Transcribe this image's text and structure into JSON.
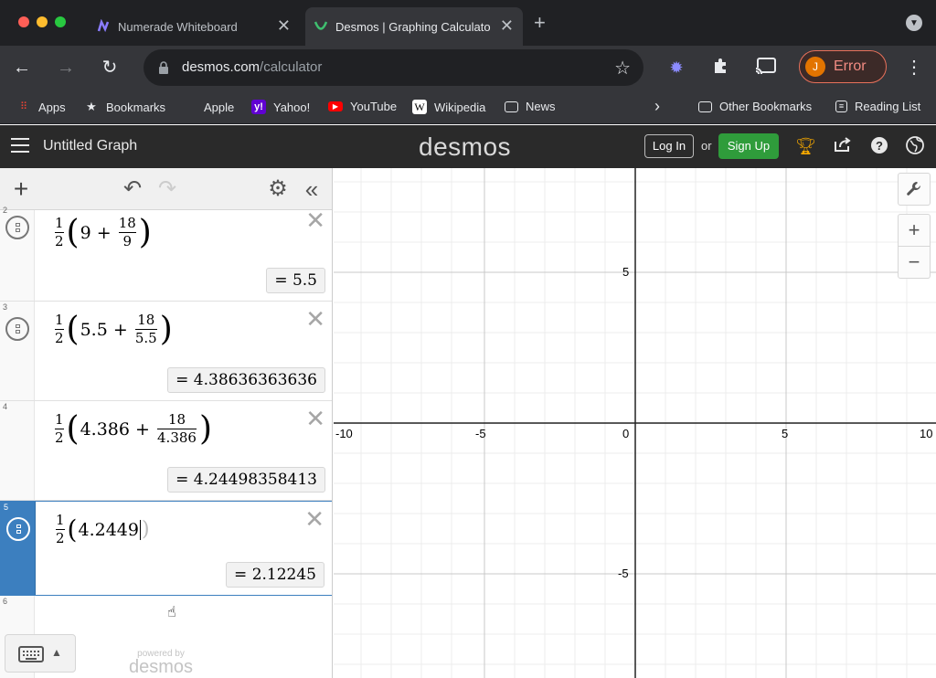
{
  "browser": {
    "tabs": [
      {
        "label": "Numerade Whiteboard",
        "icon": "numerade-icon"
      },
      {
        "label": "Desmos | Graphing Calculator",
        "icon": "desmos-icon"
      }
    ],
    "url_host": "desmos.com",
    "url_path": "/calculator",
    "profile_initial": "J",
    "profile_status": "Error",
    "bookmarks": [
      "Apps",
      "Bookmarks",
      "Apple",
      "Yahoo!",
      "YouTube",
      "Wikipedia",
      "News"
    ],
    "other_bookmarks": "Other Bookmarks",
    "reading_list": "Reading List"
  },
  "desmos": {
    "graph_title": "Untitled Graph",
    "logo": "desmos",
    "login_label": "Log In",
    "or_label": "or",
    "signup_label": "Sign Up",
    "powered_by": "powered by",
    "powered_logo": "desmos"
  },
  "expressions": [
    {
      "number": "2",
      "coef_num": "1",
      "coef_den": "2",
      "term": "9",
      "plus": "+",
      "frac_num": "18",
      "frac_den": "9",
      "result": "= 5.5"
    },
    {
      "number": "3",
      "coef_num": "1",
      "coef_den": "2",
      "term": "5.5",
      "plus": "+",
      "frac_num": "18",
      "frac_den": "5.5",
      "result": "= 4.38636363636"
    },
    {
      "number": "4",
      "coef_num": "1",
      "coef_den": "2",
      "term": "4.386",
      "plus": "+",
      "frac_num": "18",
      "frac_den": "4.386",
      "result": "= 4.24498358413"
    },
    {
      "number": "5",
      "coef_num": "1",
      "coef_den": "2",
      "term": "4.2449",
      "result": "= 2.12245"
    },
    {
      "number": "6"
    }
  ],
  "graph": {
    "x_ticks": [
      "-10",
      "-5",
      "0",
      "5",
      "10"
    ],
    "y_ticks": [
      "5",
      "-5"
    ]
  }
}
